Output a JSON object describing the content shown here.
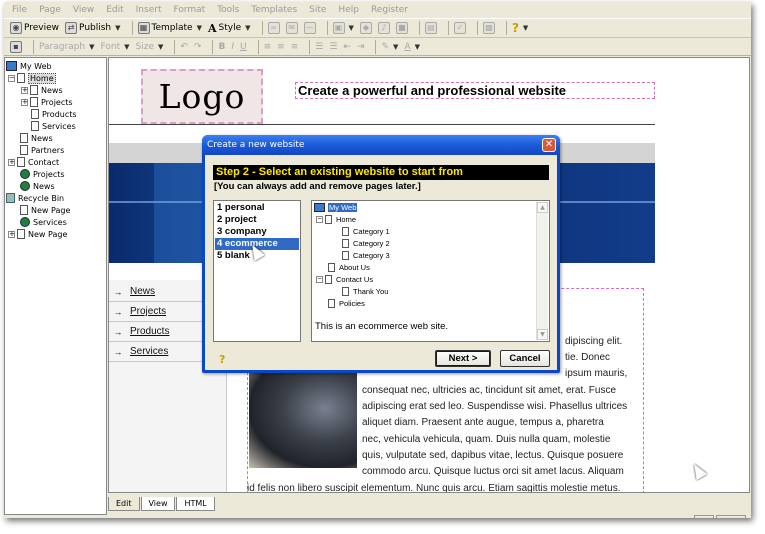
{
  "menu": [
    "File",
    "Page",
    "View",
    "Edit",
    "Insert",
    "Format",
    "Tools",
    "Templates",
    "Site",
    "Help",
    "Register"
  ],
  "toolbar1": {
    "preview": "Preview",
    "publish": "Publish",
    "template": "Template",
    "style": "Style",
    "help_glyph": "?"
  },
  "toolbar2": {
    "paragraph": "Paragraph",
    "font": "Font",
    "size": "Size",
    "bold": "B",
    "italic": "I",
    "underline": "U",
    "text_color": "A"
  },
  "tree": {
    "root": "My Web",
    "home": "Home",
    "news": "News",
    "projects": "Projects",
    "products": "Products",
    "services": "Services",
    "news2": "News",
    "partners": "Partners",
    "contact": "Contact",
    "projects2": "Projects",
    "news3": "News",
    "recycle": "Recycle Bin",
    "newpage1": "New Page",
    "services2": "Services",
    "newpage2": "New Page"
  },
  "page": {
    "logo": "Logo",
    "headline": "Create a powerful and professional website",
    "nav": [
      "News",
      "Projects",
      "Products",
      "Services"
    ],
    "body_lines": [
      "dipiscing elit.",
      "tie. Donec",
      "ipsum mauris,",
      "consequat nec, ultricies ac, tincidunt sit amet, erat. Fusce",
      "adipiscing erat sed leo. Suspendisse wisi. Phasellus ultrices",
      "aliquet diam. Praesent ante augue, tempus a, pharetra",
      "nec, vehicula vehicula, quam. Duis nulla quam, molestie",
      "quis, vulputate sed, dapibus vitae, lectus. Quisque posuere",
      "commodo arcu. Quisque luctus orci sit amet lacus. Aliquam",
      "id felis non libero suscipit elementum. Nunc quis arcu. Etiam sagittis molestie metus."
    ]
  },
  "editor_tabs": [
    "Edit",
    "View",
    "HTML"
  ],
  "dialog": {
    "title": "Create a new website",
    "close": "✕",
    "step": "Step 2 - Select an existing website to start from",
    "subtitle": "[You can always add and remove pages later.]",
    "options": [
      "1 personal",
      "2 project",
      "3 company",
      "4 ecommerce",
      "5 blank"
    ],
    "selected_option": "4 ecommerce",
    "preview_tree": {
      "root": "My Web",
      "home": "Home",
      "cat1": "Category 1",
      "cat2": "Category 2",
      "cat3": "Category 3",
      "about": "About Us",
      "contact": "Contact Us",
      "thanks": "Thank You",
      "policies": "Policies"
    },
    "description": "This is an ecommerce web site.",
    "next": "Next >",
    "cancel": "Cancel",
    "help_glyph": "?"
  }
}
